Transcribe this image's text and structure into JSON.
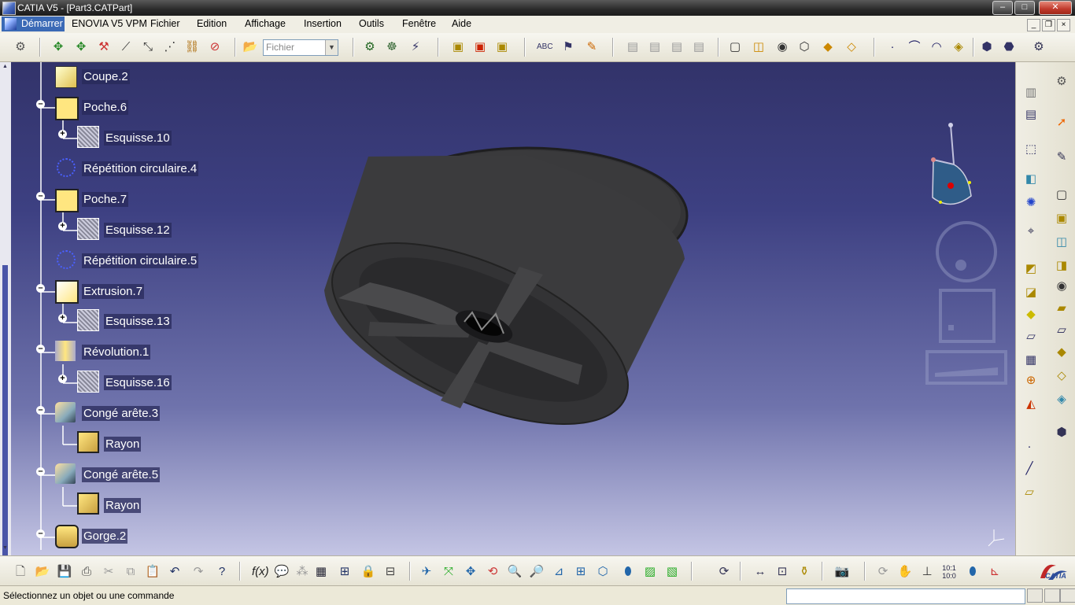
{
  "window": {
    "title": "CATIA V5 - [Part3.CATPart]",
    "minimize": "–",
    "maximize": "□",
    "close": "✕"
  },
  "menu": {
    "start": "Démarrer",
    "items": [
      "ENOVIA V5 VPM",
      "Fichier",
      "Edition",
      "Affichage",
      "Insertion",
      "Outils",
      "Fenêtre",
      "Aide"
    ]
  },
  "toolbar": {
    "file_combo": "Fichier"
  },
  "tree": [
    {
      "label": "Coupe.2",
      "icon": "split-icon"
    },
    {
      "label": "Poche.6",
      "icon": "pocket-icon",
      "expander": "–"
    },
    {
      "label": "Esquisse.10",
      "icon": "sketch-icon",
      "expander": "+"
    },
    {
      "label": "Répétition circulaire.4",
      "icon": "circular-pattern-icon"
    },
    {
      "label": "Poche.7",
      "icon": "pocket-icon",
      "expander": "–"
    },
    {
      "label": "Esquisse.12",
      "icon": "sketch-icon",
      "expander": "+"
    },
    {
      "label": "Répétition circulaire.5",
      "icon": "circular-pattern-icon"
    },
    {
      "label": "Extrusion.7",
      "icon": "pad-icon",
      "expander": "–"
    },
    {
      "label": "Esquisse.13",
      "icon": "sketch-icon",
      "expander": "+"
    },
    {
      "label": "Révolution.1",
      "icon": "shaft-icon",
      "expander": "–"
    },
    {
      "label": "Esquisse.16",
      "icon": "sketch-icon",
      "expander": "+"
    },
    {
      "label": "Congé arête.3",
      "icon": "edge-fillet-icon",
      "expander": "–"
    },
    {
      "label": "Rayon",
      "icon": "radius-parameter-icon"
    },
    {
      "label": "Congé arête.5",
      "icon": "edge-fillet-icon",
      "expander": "–"
    },
    {
      "label": "Rayon",
      "icon": "radius-parameter-icon"
    },
    {
      "label": "Gorge.2",
      "icon": "groove-icon",
      "expander": "–"
    }
  ],
  "status": {
    "message": "Sélectionnez un objet ou une commande",
    "command_input": ""
  },
  "brand": {
    "logo_text": "CATIA"
  },
  "colors": {
    "viewport_top": "#32336a",
    "viewport_bottom": "#c4c5e4",
    "tree_text": "#ffffff",
    "model": "#3c3c3e"
  }
}
